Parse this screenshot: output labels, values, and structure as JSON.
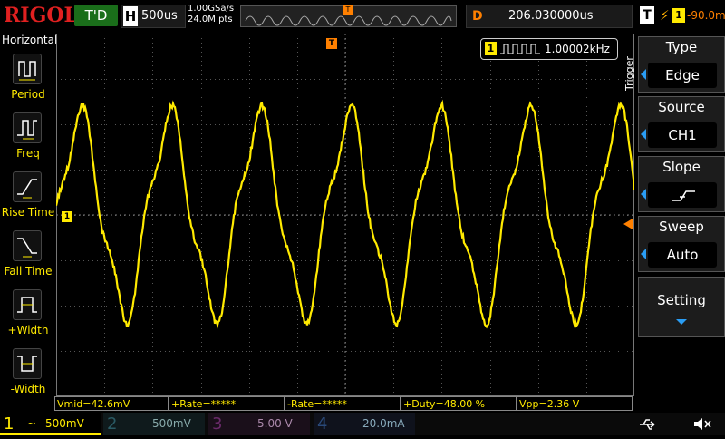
{
  "brand": "RIGOL",
  "status": {
    "run_state": "T'D",
    "horizontal_label": "H",
    "timebase": "500us",
    "sample_rate": "1.00GSa/s",
    "memory_points": "24.0M pts",
    "trigger_pos_marker": "T",
    "delay_label": "D",
    "delay_value": "206.030000us",
    "trigger_label": "T",
    "trigger_channel": "1",
    "trigger_level": "-90.0mV"
  },
  "left_menu": {
    "title": "Horizontal",
    "items": [
      {
        "label": "Period"
      },
      {
        "label": "Freq"
      },
      {
        "label": "Rise Time"
      },
      {
        "label": "Fall Time"
      },
      {
        "label": "+Width"
      },
      {
        "label": "-Width"
      }
    ]
  },
  "screen": {
    "trigger_top_marker": "T",
    "channel_marker": "1",
    "freq_channel": "1",
    "freq_value": "1.00002kHz"
  },
  "measurements": [
    {
      "label": "Vmid=42.6mV"
    },
    {
      "label": "+Rate=*****"
    },
    {
      "label": "-Rate=*****"
    },
    {
      "label": "+Duty=48.00 %"
    },
    {
      "label": "Vpp=2.36 V"
    }
  ],
  "channels": [
    {
      "num": "1",
      "coupling": "~",
      "scale": "500mV",
      "color": "#ffea00"
    },
    {
      "num": "2",
      "scale": "500mV",
      "color": "#2ec4e8"
    },
    {
      "num": "3",
      "scale": "5.00 V",
      "color": "#e040e0"
    },
    {
      "num": "4",
      "scale": "20.0mA",
      "color": "#3090ff"
    }
  ],
  "right_menu": {
    "side_label": "Trigger",
    "items": [
      {
        "title": "Type",
        "value": "Edge"
      },
      {
        "title": "Source",
        "value": "CH1"
      },
      {
        "title": "Slope",
        "value": ""
      },
      {
        "title": "Sweep",
        "value": "Auto"
      },
      {
        "title": "Setting",
        "value": ""
      }
    ]
  },
  "waveform": {
    "channel": "CH1",
    "color": "#ffea00",
    "frequency_hz": 1000.02,
    "cycles_visible": 6
  },
  "colors": {
    "ch1": "#ffea00",
    "trigger_marker": "#ff8000",
    "run_state_bg": "#1a6e1a",
    "brand": "#e02020",
    "menu_accent": "#2a9df4"
  }
}
